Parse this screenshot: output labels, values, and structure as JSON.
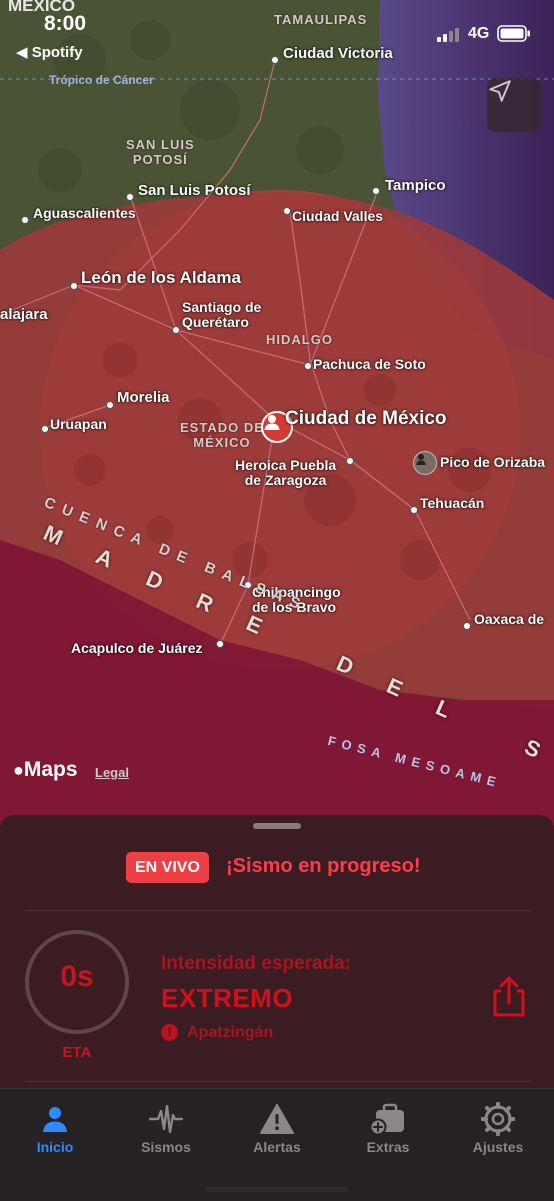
{
  "status_bar": {
    "region_header": "MEXICO",
    "time": "8:00",
    "back_app": "◀ Spotify",
    "network": "4G"
  },
  "map": {
    "regions": {
      "tamaulipas": "TAMAULIPAS",
      "san_luis_potosi": "SAN LUIS\nPOTOSÍ",
      "hidalgo": "HIDALGO",
      "estado_mexico": "ESTADO DE\nMÉXICO"
    },
    "tropic_label": "Trópico de Cáncer",
    "cities": {
      "ciudad_victoria": "Ciudad Victoria",
      "tampico": "Tampico",
      "san_luis_potosi": "San Luis Potosí",
      "aguascalientes": "Aguascalientes",
      "ciudad_valles": "Ciudad Valles",
      "leon": "León de los Aldama",
      "guadalajara": "alajara",
      "queretaro": "Santiago de\nQuerétaro",
      "pachuca": "Pachuca de Soto",
      "morelia": "Morelia",
      "uruapan": "Uruapan",
      "cdmx": "Ciudad de México",
      "puebla": "Heroica Puebla\nde Zaragoza",
      "orizaba": "Pico de Orizaba",
      "tehuacan": "Tehuacán",
      "chilpancingo": "Chilpancingo\nde los Bravo",
      "oaxaca": "Oaxaca de",
      "acapulco": "Acapulco de Juárez"
    },
    "geo": {
      "balsas": "CUENCA DE BALSAS",
      "madre": "MADRE DEL SU",
      "trench": "FOSA MESOAME"
    },
    "maps_logo": "Maps",
    "legal": "Legal"
  },
  "alert": {
    "badge": "EN VIVO",
    "headline": "¡Sismo en progreso!",
    "eta_value": "0s",
    "eta_label": "ETA",
    "intensity_label": "Intensidad esperada:",
    "intensity_value": "EXTREMO",
    "location": "Apatzingán"
  },
  "tabs": [
    {
      "label": "Inicio",
      "icon": "person-icon",
      "active": true
    },
    {
      "label": "Sismos",
      "icon": "seismograph-icon",
      "active": false
    },
    {
      "label": "Alertas",
      "icon": "warning-icon",
      "active": false
    },
    {
      "label": "Extras",
      "icon": "briefcase-plus-icon",
      "active": false
    },
    {
      "label": "Ajustes",
      "icon": "gear-icon",
      "active": false
    }
  ],
  "colors": {
    "alert_red": "#ff3b47",
    "intensity_red": "#d0101c",
    "tab_active": "#2f8bff",
    "tab_inactive": "#8b8688"
  }
}
